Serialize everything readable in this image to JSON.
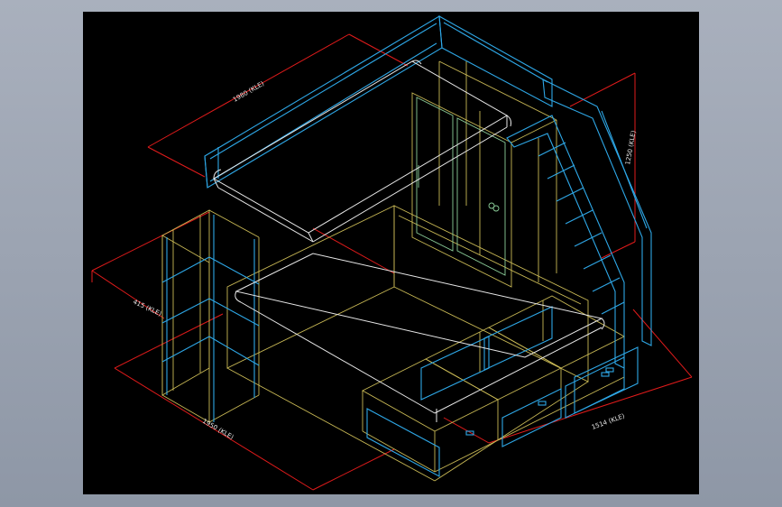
{
  "drawing": {
    "colors": {
      "background": "#000000",
      "frame_bg": "#9aa2b0",
      "rail": "#2ea7e6",
      "frame_yellow": "#c9b955",
      "white": "#e8e8e8",
      "green": "#8ccf9a",
      "dimension": "#e11b1b"
    },
    "dimensions": {
      "top_length": "1980 (KLE)",
      "right_height": "1250 (KLE)",
      "left_height": "415 (KLE)",
      "bottom_left": "1950 (KLE)",
      "bottom_right": "1514 (KLE)"
    }
  }
}
